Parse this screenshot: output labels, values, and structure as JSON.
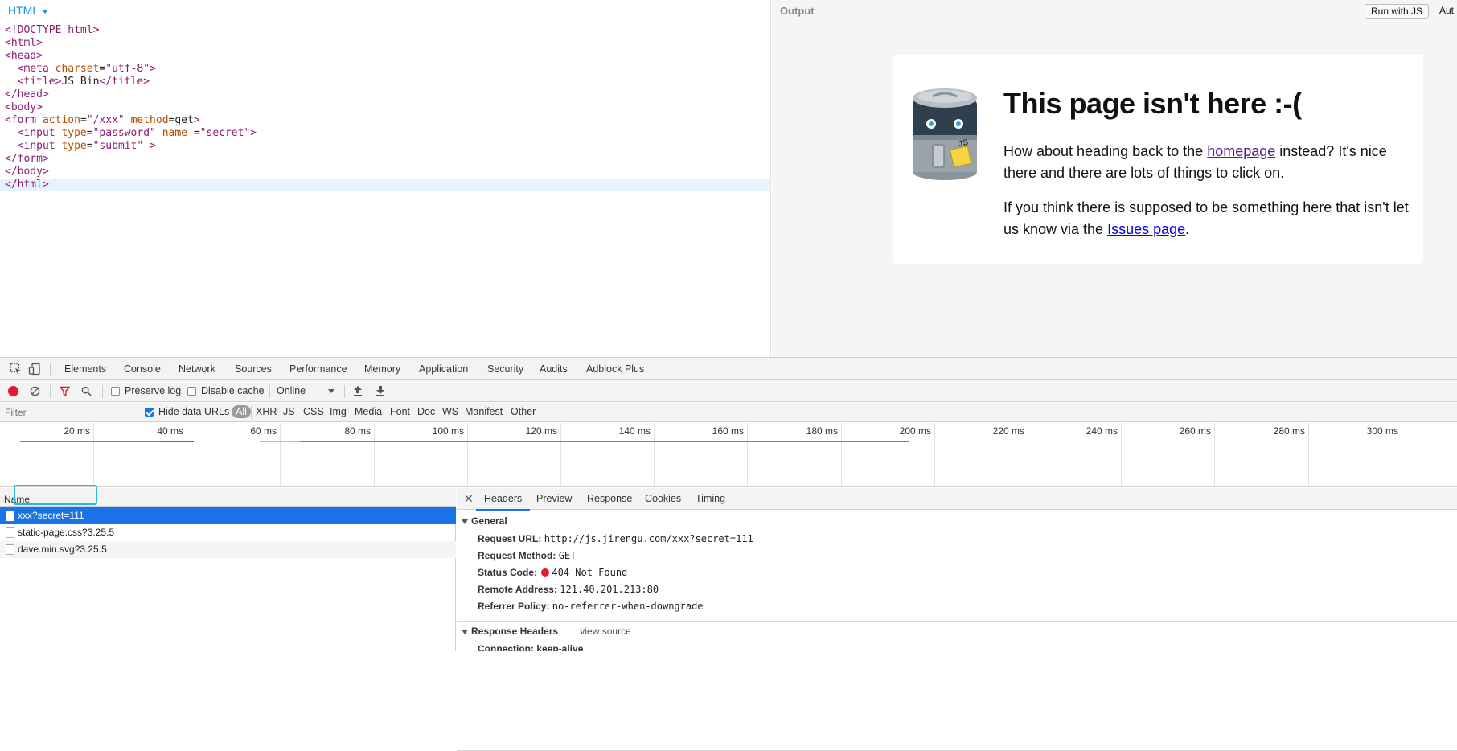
{
  "editor": {
    "language_label": "HTML",
    "code_lines": [
      [
        {
          "c": "t-tag",
          "t": "<!DOCTYPE html>"
        }
      ],
      [
        {
          "c": "t-tag",
          "t": "<html>"
        }
      ],
      [
        {
          "c": "t-tag",
          "t": "<head>"
        }
      ],
      [
        {
          "c": "t-txt",
          "t": "  "
        },
        {
          "c": "t-tag",
          "t": "<meta "
        },
        {
          "c": "t-attr",
          "t": "charset"
        },
        {
          "c": "t-txt",
          "t": "="
        },
        {
          "c": "t-str",
          "t": "\"utf-8\""
        },
        {
          "c": "t-tag",
          "t": ">"
        }
      ],
      [
        {
          "c": "t-txt",
          "t": "  "
        },
        {
          "c": "t-tag",
          "t": "<title>"
        },
        {
          "c": "t-txt",
          "t": "JS Bin"
        },
        {
          "c": "t-tag",
          "t": "</title>"
        }
      ],
      [
        {
          "c": "t-tag",
          "t": "</head>"
        }
      ],
      [
        {
          "c": "t-tag",
          "t": "<body>"
        }
      ],
      [
        {
          "c": "t-tag",
          "t": "<form "
        },
        {
          "c": "t-attr",
          "t": "action"
        },
        {
          "c": "t-txt",
          "t": "="
        },
        {
          "c": "t-str",
          "t": "\"/xxx\""
        },
        {
          "c": "t-txt",
          "t": " "
        },
        {
          "c": "t-attr",
          "t": "method"
        },
        {
          "c": "t-txt",
          "t": "=get"
        },
        {
          "c": "t-tag",
          "t": ">"
        }
      ],
      [
        {
          "c": "t-txt",
          "t": "  "
        },
        {
          "c": "t-tag",
          "t": "<input "
        },
        {
          "c": "t-attr",
          "t": "type"
        },
        {
          "c": "t-txt",
          "t": "="
        },
        {
          "c": "t-str",
          "t": "\"password\""
        },
        {
          "c": "t-txt",
          "t": " "
        },
        {
          "c": "t-attr",
          "t": "name "
        },
        {
          "c": "t-txt",
          "t": "="
        },
        {
          "c": "t-str",
          "t": "\"secret\""
        },
        {
          "c": "t-tag",
          "t": ">"
        }
      ],
      [
        {
          "c": "t-txt",
          "t": "  "
        },
        {
          "c": "t-tag",
          "t": "<input "
        },
        {
          "c": "t-attr",
          "t": "type"
        },
        {
          "c": "t-txt",
          "t": "="
        },
        {
          "c": "t-str",
          "t": "\"submit\""
        },
        {
          "c": "t-txt",
          "t": " "
        },
        {
          "c": "t-tag",
          "t": ">"
        }
      ],
      [
        {
          "c": "t-tag",
          "t": "</form>"
        }
      ],
      [
        {
          "c": "t-tag",
          "t": "</body>"
        }
      ],
      [
        {
          "c": "t-tag",
          "t": "</html>"
        }
      ]
    ],
    "active_line": 12
  },
  "output": {
    "label": "Output",
    "run_button": "Run with JS",
    "auto_text": "Aut",
    "title": "This page isn't here :-(",
    "p1_before": "How about heading back to the ",
    "p1_link": "homepage",
    "p1_after": " instead? It's nice there and there are lots of things to click on.",
    "p2_before": "If you think there is supposed to be something here that isn't let us know via the ",
    "p2_link": "Issues page",
    "p2_after": ".",
    "mascot_badge": "JS"
  },
  "devtools": {
    "tabs": [
      "Elements",
      "Console",
      "Network",
      "Sources",
      "Performance",
      "Memory",
      "Application",
      "Security",
      "Audits",
      "Adblock Plus"
    ],
    "active_tab": "Network",
    "toolbar": {
      "preserve_log": "Preserve log",
      "disable_cache": "Disable cache",
      "throttle": "Online"
    },
    "filter": {
      "placeholder": "Filter",
      "hide_data_urls": "Hide data URLs",
      "types": [
        "All",
        "XHR",
        "JS",
        "CSS",
        "Img",
        "Media",
        "Font",
        "Doc",
        "WS",
        "Manifest",
        "Other"
      ],
      "active_type": "All"
    },
    "timeline": {
      "ticks": [
        "20 ms",
        "40 ms",
        "60 ms",
        "80 ms",
        "100 ms",
        "120 ms",
        "140 ms",
        "160 ms",
        "180 ms",
        "200 ms",
        "220 ms",
        "240 ms",
        "260 ms",
        "280 ms",
        "300 ms"
      ]
    },
    "requests": {
      "header": "Name",
      "rows": [
        "xxx?secret=111",
        "static-page.css?3.25.5",
        "dave.min.svg?3.25.5"
      ],
      "selected_index": 0
    },
    "details": {
      "tabs": [
        "Headers",
        "Preview",
        "Response",
        "Cookies",
        "Timing"
      ],
      "active_tab": "Headers",
      "general_title": "General",
      "general": [
        {
          "key": "Request URL:",
          "value": "http://js.jirengu.com/xxx?secret=111"
        },
        {
          "key": "Request Method:",
          "value": "GET"
        },
        {
          "key": "Status Code:",
          "value": "404 Not Found"
        },
        {
          "key": "Remote Address:",
          "value": "121.40.201.213:80"
        },
        {
          "key": "Referrer Policy:",
          "value": "no-referrer-when-downgrade"
        }
      ],
      "response_headers_title": "Response Headers",
      "view_source": "view source",
      "next_row_partial": "Connection: keep-alive"
    },
    "colors": {
      "accent": "#1a73e8",
      "status_error": "#e8192c",
      "highlight_box": "#27b7ea"
    }
  }
}
